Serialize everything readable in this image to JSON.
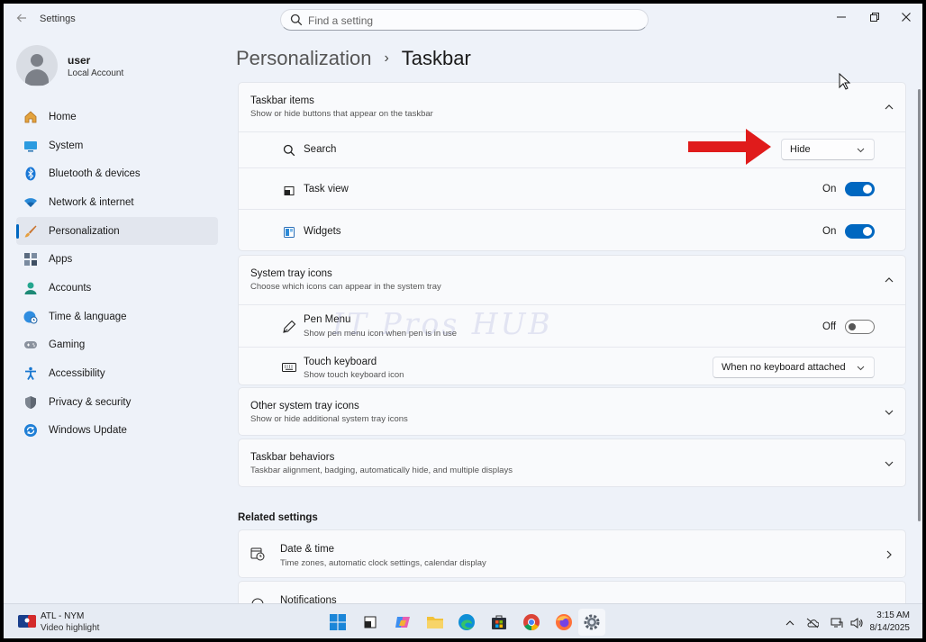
{
  "window": {
    "title": "Settings",
    "search_placeholder": "Find a setting"
  },
  "profile": {
    "name": "user",
    "account_type": "Local Account"
  },
  "nav": {
    "items": [
      {
        "label": "Home",
        "icon": "home-icon"
      },
      {
        "label": "System",
        "icon": "system-icon"
      },
      {
        "label": "Bluetooth & devices",
        "icon": "bluetooth-icon"
      },
      {
        "label": "Network & internet",
        "icon": "wifi-icon"
      },
      {
        "label": "Personalization",
        "icon": "brush-icon",
        "active": true
      },
      {
        "label": "Apps",
        "icon": "apps-icon"
      },
      {
        "label": "Accounts",
        "icon": "accounts-icon"
      },
      {
        "label": "Time & language",
        "icon": "globe-clock-icon"
      },
      {
        "label": "Gaming",
        "icon": "gamepad-icon"
      },
      {
        "label": "Accessibility",
        "icon": "accessibility-icon"
      },
      {
        "label": "Privacy & security",
        "icon": "shield-icon"
      },
      {
        "label": "Windows Update",
        "icon": "update-icon"
      }
    ]
  },
  "breadcrumb": {
    "parent": "Personalization",
    "separator": "›",
    "current": "Taskbar"
  },
  "taskbar_items": {
    "title": "Taskbar items",
    "description": "Show or hide buttons that appear on the taskbar",
    "search": {
      "label": "Search",
      "value": "Hide"
    },
    "task_view": {
      "label": "Task view",
      "state": "On"
    },
    "widgets": {
      "label": "Widgets",
      "state": "On"
    }
  },
  "system_tray": {
    "title": "System tray icons",
    "description": "Choose which icons can appear in the system tray",
    "pen_menu": {
      "label": "Pen Menu",
      "description": "Show pen menu icon when pen is in use",
      "state": "Off"
    },
    "touch_keyboard": {
      "label": "Touch keyboard",
      "description": "Show touch keyboard icon",
      "value": "When no keyboard attached"
    }
  },
  "other_tray": {
    "title": "Other system tray icons",
    "description": "Show or hide additional system tray icons"
  },
  "behaviors": {
    "title": "Taskbar behaviors",
    "description": "Taskbar alignment, badging, automatically hide, and multiple displays"
  },
  "related": {
    "title": "Related settings",
    "date_time": {
      "label": "Date & time",
      "description": "Time zones, automatic clock settings, calendar display"
    },
    "notifications": {
      "label": "Notifications"
    }
  },
  "watermark": "IT Pros HUB",
  "taskbar": {
    "widget_title": "ATL - NYM",
    "widget_sub": "Video highlight",
    "time": "3:15 AM",
    "date": "8/14/2025"
  },
  "colors": {
    "accent": "#0067c0",
    "arrow": "#e01b1b"
  }
}
